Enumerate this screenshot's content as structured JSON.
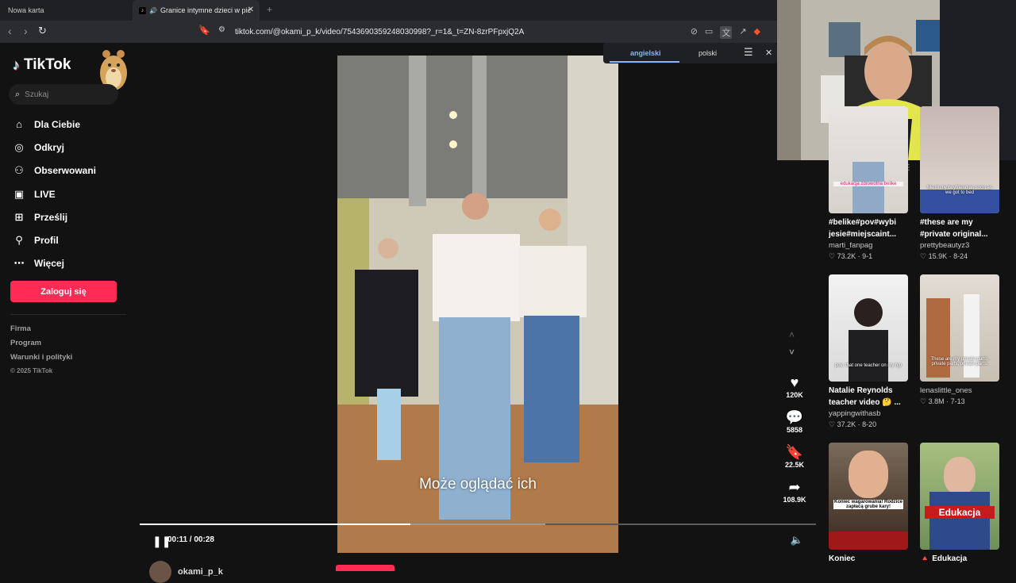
{
  "browser": {
    "tab1_title": "Nowa karta",
    "tab2_title": "Granice intymne dzieci w pic",
    "url": "tiktok.com/@okami_p_k/video/7543690359248030998?_r=1&_t=ZN-8zrPFpxjQ2A"
  },
  "translate_bar": {
    "lang_from": "angielski",
    "lang_to": "polski"
  },
  "sidebar": {
    "logo": "TikTok",
    "search_placeholder": "Szukaj",
    "items": [
      {
        "label": "Dla Ciebie",
        "icon": "home-icon"
      },
      {
        "label": "Odkryj",
        "icon": "compass-icon"
      },
      {
        "label": "Obserwowani",
        "icon": "following-icon"
      },
      {
        "label": "LIVE",
        "icon": "live-icon"
      },
      {
        "label": "Prześlij",
        "icon": "upload-icon"
      },
      {
        "label": "Profil",
        "icon": "profile-icon"
      },
      {
        "label": "Więcej",
        "icon": "more-icon"
      }
    ],
    "login_label": "Zaloguj się",
    "footer": [
      "Firma",
      "Program",
      "Warunki i polityki"
    ],
    "copyright": "© 2025 TikTok"
  },
  "player": {
    "caption": "Może oglądać ich",
    "time": "00:11 / 00:28",
    "progress": 0.4,
    "buffered": 0.6,
    "likes": "120K",
    "comments": "5858",
    "saves": "22.5K",
    "shares": "108.9K",
    "author": "okami_p_k"
  },
  "recommended": [
    {
      "title": "#belike#pov#wybi jesie#miejscaint...",
      "user": "marti_fanpag",
      "likes": "73.2K",
      "date": "9-1",
      "thumb_text": "edukacja zdrowotna belike"
    },
    {
      "title": "#these are my #private original...",
      "user": "prettybeautyz3",
      "likes": "15.9K",
      "date": "8-24",
      "thumb_text": "Me to my boyfriend as soon as we got to bed"
    },
    {
      "title": "Natalie Reynolds teacher video 🤔 ...",
      "user": "yappingwithasb",
      "likes": "37.2K",
      "date": "8-20",
      "thumb_text": "pov: that one teacher on my fyp"
    },
    {
      "title": "",
      "user": "lenaslittle_ones",
      "likes": "3.8M",
      "date": "7-13",
      "thumb_text": "These are my private parts, private parts, private parts."
    },
    {
      "title": "Koniec",
      "user": "",
      "likes": "",
      "date": "",
      "thumb_text": "Koniec wagarowania! Rodzice zapłacą grube kary!"
    },
    {
      "title": "🔺 Edukacja",
      "user": "",
      "likes": "",
      "date": "",
      "thumb_text": "Edukacja"
    }
  ]
}
